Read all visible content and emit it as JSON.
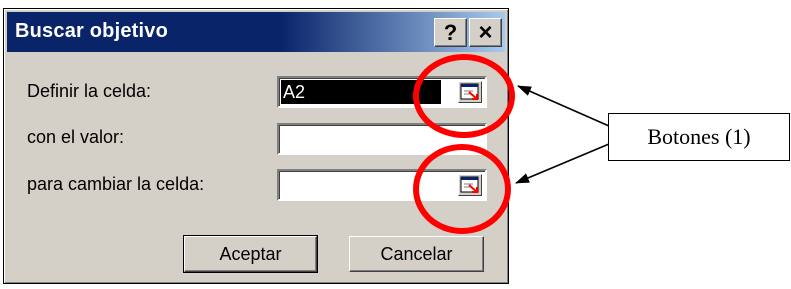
{
  "dialog": {
    "title": "Buscar objetivo",
    "help_label": "?",
    "close_label": "×",
    "fields": [
      {
        "label": "Definir la celda:",
        "value": "A2"
      },
      {
        "label": "con el valor:",
        "value": ""
      },
      {
        "label": "para cambiar la celda:",
        "value": ""
      }
    ],
    "buttons": {
      "accept": "Aceptar",
      "cancel": "Cancelar"
    }
  },
  "annotation": {
    "callout": "Botones (1)",
    "circle_color": "#ff0000"
  },
  "colors": {
    "titlebar": "#0a246a",
    "face": "#d4d0c8"
  }
}
